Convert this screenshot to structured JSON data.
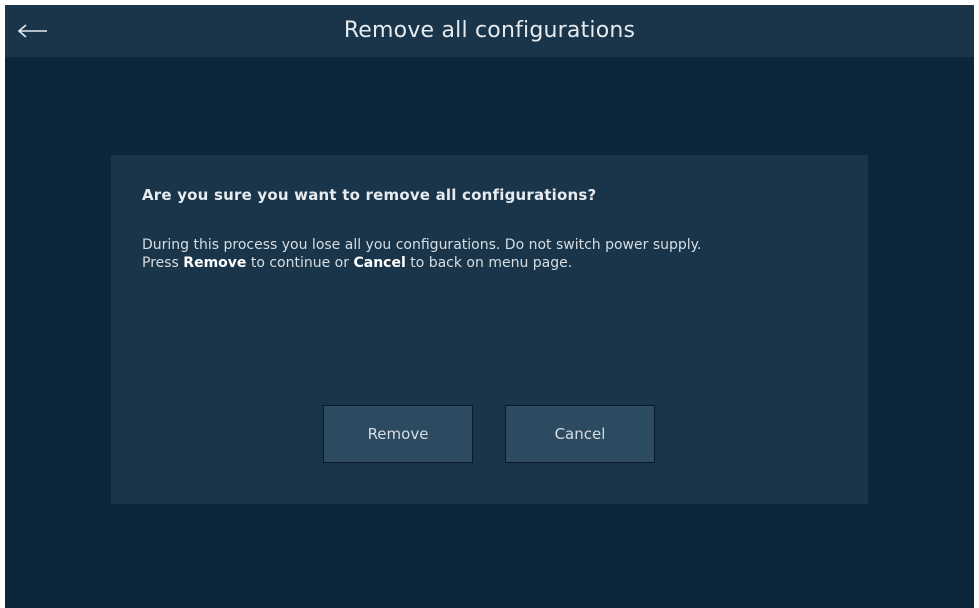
{
  "header": {
    "title": "Remove all configurations",
    "back_icon": "arrow-left-icon"
  },
  "dialog": {
    "question": "Are you sure you want to remove all configurations?",
    "message_line1": "During this process you lose all you configurations. Do not switch power supply.",
    "message_line2_pre": "Press ",
    "message_line2_remove": "Remove",
    "message_line2_mid": " to continue or ",
    "message_line2_cancel": "Cancel",
    "message_line2_post": " to back on menu page.",
    "remove_label": "Remove",
    "cancel_label": "Cancel"
  },
  "colors": {
    "background": "#0b2539",
    "panel": "#1a3549",
    "button": "#2d4b60",
    "text": "#e6ebef"
  }
}
